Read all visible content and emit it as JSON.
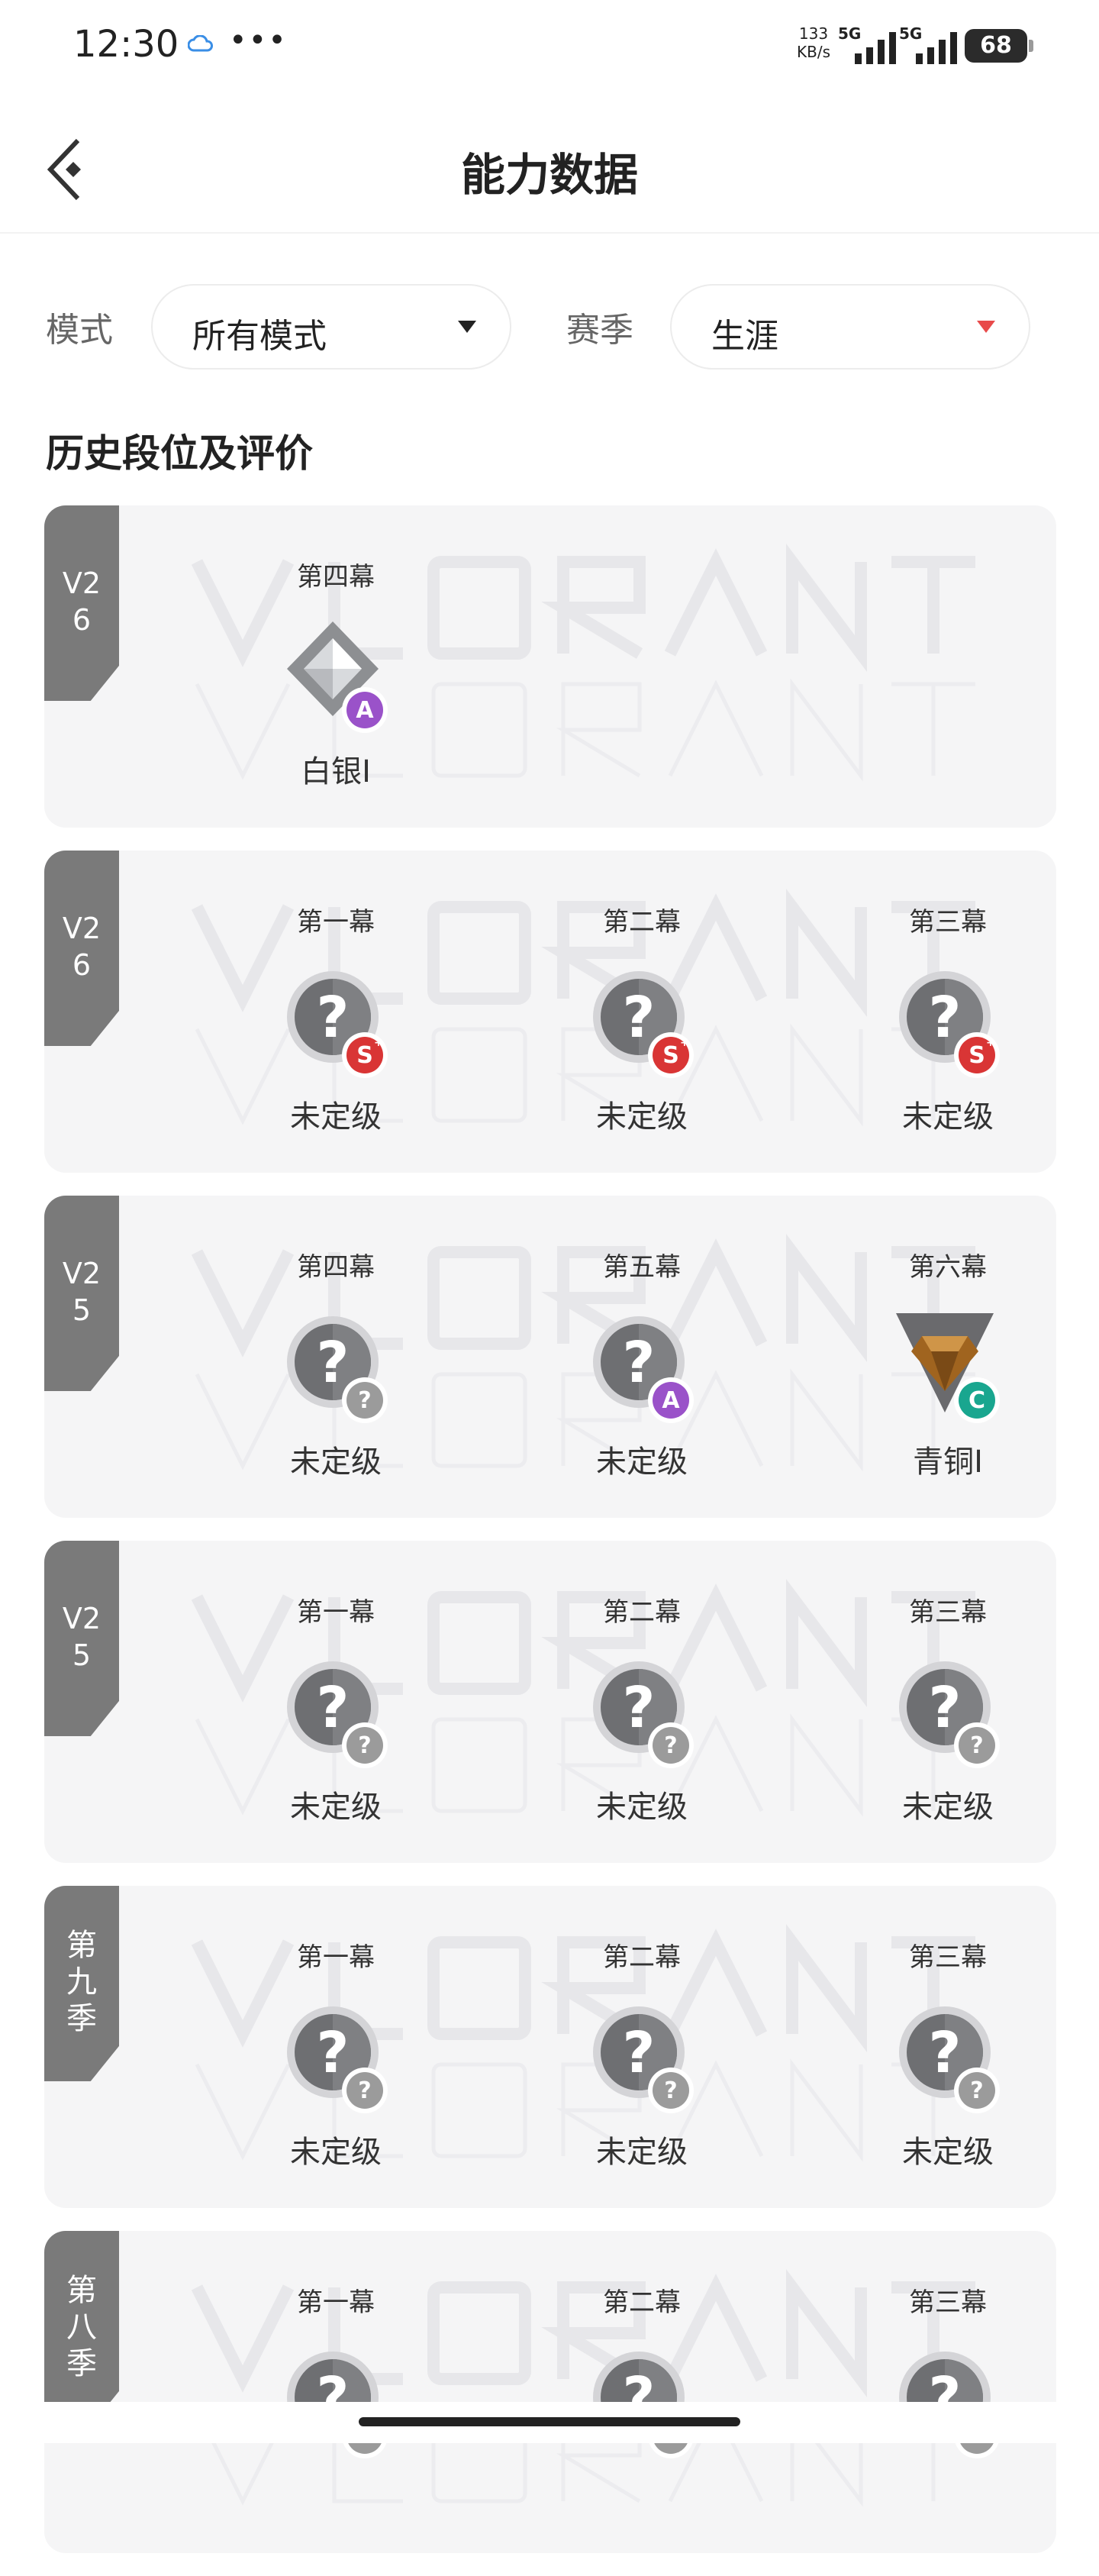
{
  "status_bar": {
    "time": "12:30",
    "dots": "•••",
    "speed_value": "133",
    "speed_unit": "KB/s",
    "signal1_label": "5G",
    "signal2_label": "5G",
    "battery": "68"
  },
  "header": {
    "title": "能力数据",
    "back_icon": "back-chevron-icon"
  },
  "filters": {
    "mode_label": "模式",
    "mode_value": "所有模式",
    "season_label": "赛季",
    "season_value": "生涯"
  },
  "section_title": "历史段位及评价",
  "colors": {
    "card_bg": "#f5f5f6",
    "tag_bg": "#7a7a7a",
    "badge_s": "#d93535",
    "badge_a": "#9a52c9",
    "badge_c": "#19a68f",
    "badge_unknown": "#9b9b9b",
    "season_arrow": "#e84a4a"
  },
  "seasons": [
    {
      "tag": "V26",
      "acts": [
        {
          "label": "第四幕",
          "rank": "白银I",
          "icon": "silver",
          "badge": "A"
        }
      ]
    },
    {
      "tag": "V26",
      "acts": [
        {
          "label": "第一幕",
          "rank": "未定级",
          "icon": "unranked",
          "badge": "S+"
        },
        {
          "label": "第二幕",
          "rank": "未定级",
          "icon": "unranked",
          "badge": "S+"
        },
        {
          "label": "第三幕",
          "rank": "未定级",
          "icon": "unranked",
          "badge": "S+"
        }
      ]
    },
    {
      "tag": "V25",
      "acts": [
        {
          "label": "第四幕",
          "rank": "未定级",
          "icon": "unranked",
          "badge": "?"
        },
        {
          "label": "第五幕",
          "rank": "未定级",
          "icon": "unranked",
          "badge": "A"
        },
        {
          "label": "第六幕",
          "rank": "青铜I",
          "icon": "bronze",
          "badge": "C"
        }
      ]
    },
    {
      "tag": "V25",
      "acts": [
        {
          "label": "第一幕",
          "rank": "未定级",
          "icon": "unranked",
          "badge": "?"
        },
        {
          "label": "第二幕",
          "rank": "未定级",
          "icon": "unranked",
          "badge": "?"
        },
        {
          "label": "第三幕",
          "rank": "未定级",
          "icon": "unranked",
          "badge": "?"
        }
      ]
    },
    {
      "tag": "第九季",
      "acts": [
        {
          "label": "第一幕",
          "rank": "未定级",
          "icon": "unranked",
          "badge": "?"
        },
        {
          "label": "第二幕",
          "rank": "未定级",
          "icon": "unranked",
          "badge": "?"
        },
        {
          "label": "第三幕",
          "rank": "未定级",
          "icon": "unranked",
          "badge": "?"
        }
      ]
    },
    {
      "tag": "第八季",
      "acts": [
        {
          "label": "第一幕",
          "rank": "",
          "icon": "unranked",
          "badge": "?"
        },
        {
          "label": "第二幕",
          "rank": "",
          "icon": "unranked",
          "badge": "?"
        },
        {
          "label": "第三幕",
          "rank": "",
          "icon": "unranked",
          "badge": "?"
        }
      ]
    }
  ]
}
